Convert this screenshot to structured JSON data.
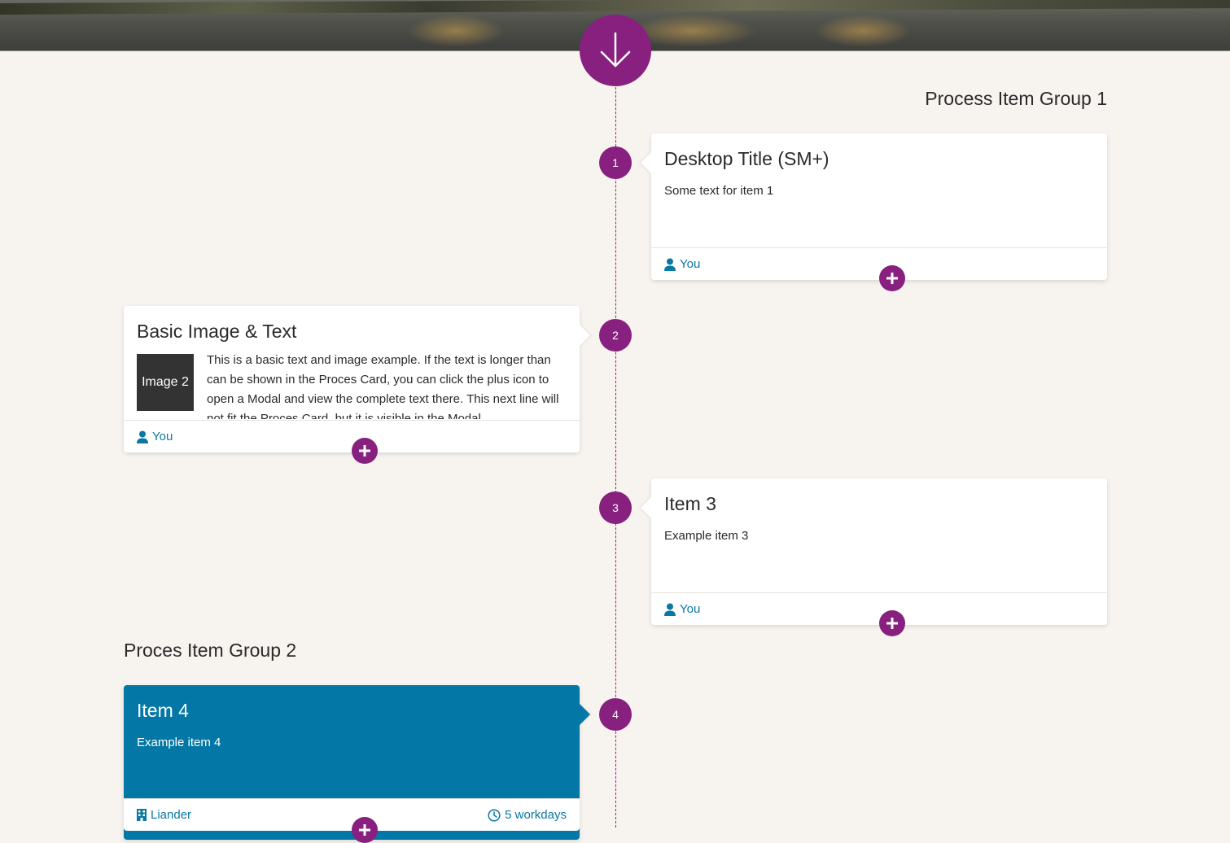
{
  "hero": {
    "icon": "arrow-down-icon"
  },
  "groups": [
    {
      "title": "Process Item Group 1"
    },
    {
      "title": "Proces Item Group 2"
    }
  ],
  "items": [
    {
      "step": "1",
      "title": "Desktop Title (SM+)",
      "text": "Some text for item 1",
      "footer_left": "You",
      "footer_left_icon": "user-icon"
    },
    {
      "step": "2",
      "title": "Basic Image & Text",
      "image_label": "Image 2",
      "text": "This is a basic text and image example. If the text is longer than can be shown in the Proces Card, you can click the plus icon to open a Modal and view the complete text there. This next line will not fit the Proces Card, but it is visible in the Modal.",
      "footer_left": "You",
      "footer_left_icon": "user-icon"
    },
    {
      "step": "3",
      "title": "Item 3",
      "text": "Example item 3",
      "footer_left": "You",
      "footer_left_icon": "user-icon"
    },
    {
      "step": "4",
      "title": "Item 4",
      "text": "Example item 4",
      "footer_left": "Liander",
      "footer_left_icon": "building-icon",
      "footer_right": "5 workdays",
      "footer_right_icon": "clock-icon",
      "color": "#0378a6"
    }
  ],
  "colors": {
    "accent": "#87207f",
    "link": "#0a78a3",
    "highlight_card": "#0378a6",
    "background": "#f7f3ef"
  }
}
